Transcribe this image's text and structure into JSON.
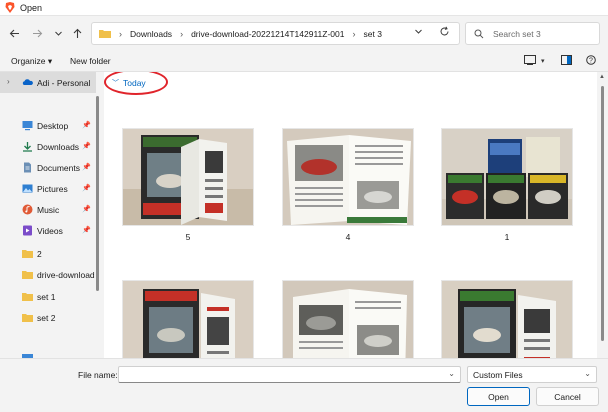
{
  "window": {
    "title": "Open"
  },
  "nav": {
    "breadcrumbs": [
      "Downloads",
      "drive-download-20221214T142911Z-001",
      "set 3"
    ],
    "search_placeholder": "Search set 3",
    "back_icon": "arrow-left-icon",
    "forward_icon": "arrow-right-icon",
    "recent_icon": "chevron-down-icon",
    "up_icon": "arrow-up-icon",
    "refresh_icon": "refresh-icon"
  },
  "toolbar": {
    "organize": "Organize",
    "new_folder": "New folder"
  },
  "sidebar": {
    "items": [
      {
        "label": "Adi - Personal",
        "icon": "onedrive-cloud-icon"
      },
      {
        "label": "Desktop",
        "icon": "desktop-icon"
      },
      {
        "label": "Downloads",
        "icon": "download-icon"
      },
      {
        "label": "Documents",
        "icon": "documents-icon"
      },
      {
        "label": "Pictures",
        "icon": "pictures-icon"
      },
      {
        "label": "Music",
        "icon": "music-icon"
      },
      {
        "label": "Videos",
        "icon": "videos-icon"
      },
      {
        "label": "2",
        "icon": "folder-icon"
      },
      {
        "label": "drive-download",
        "icon": "folder-icon"
      },
      {
        "label": "set 1",
        "icon": "folder-icon"
      },
      {
        "label": "set 2",
        "icon": "folder-icon"
      }
    ]
  },
  "content": {
    "group_header": "Today",
    "files": [
      {
        "name": "5"
      },
      {
        "name": "4"
      },
      {
        "name": "1"
      },
      {
        "name": ""
      },
      {
        "name": ""
      },
      {
        "name": ""
      }
    ]
  },
  "bottom": {
    "file_name_label": "File name:",
    "file_name_value": "",
    "filter_value": "Custom Files",
    "open_label": "Open",
    "cancel_label": "Cancel"
  },
  "colors": {
    "accent": "#0067c0",
    "annotation": "#e0242b",
    "folder": "#f0c04a"
  }
}
